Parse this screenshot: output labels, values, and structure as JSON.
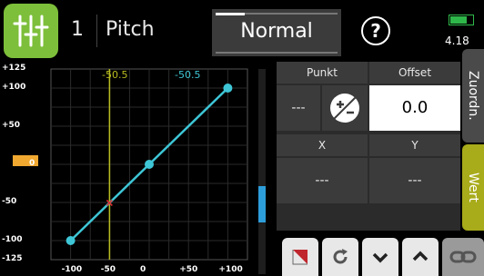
{
  "header": {
    "model_number": "1",
    "model_name": "Pitch",
    "mode": "Normal",
    "help_symbol": "?",
    "battery_voltage": "4.18",
    "app_icon": "sliders-icon"
  },
  "graph": {
    "y_ticks": [
      "+125",
      "+100",
      "+50",
      "0",
      "-50",
      "-100",
      "-125"
    ],
    "x_ticks": [
      "-100",
      "-50",
      "0",
      "+50",
      "+100"
    ],
    "cursor_label_primary": "-50.5",
    "cursor_label_secondary": "-50.5",
    "curve_points": [
      [
        -100,
        -100
      ],
      [
        0,
        0
      ],
      [
        100,
        100
      ]
    ],
    "cursor_x": -50.5,
    "output_y": 0,
    "colors": {
      "curve": "#3ec6d6",
      "cursor": "#b8bc20",
      "marker": "#f0a830"
    }
  },
  "table": {
    "header_punkt": "Punkt",
    "header_offset": "Offset",
    "punkt_value": "---",
    "offset_value": "0.0",
    "header_x": "X",
    "header_y": "Y",
    "x_value": "---",
    "y_value": "---"
  },
  "tabs": {
    "zuordn": "Zuordn.",
    "wert": "Wert"
  },
  "toolbar": {
    "buttons": [
      "corner-icon",
      "refresh-icon",
      "chevron-down-icon",
      "chevron-up-icon",
      "link-icon"
    ]
  }
}
